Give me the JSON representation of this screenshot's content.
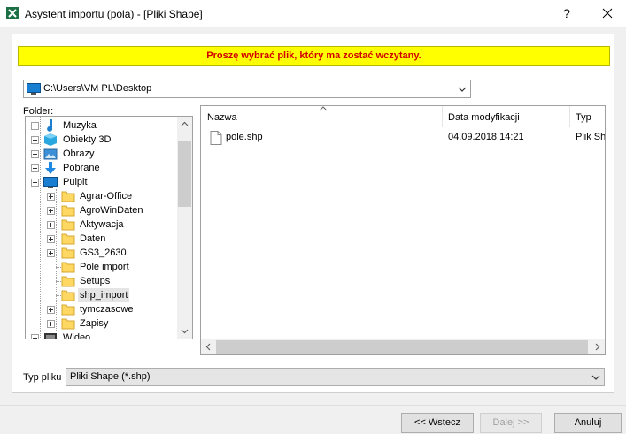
{
  "window": {
    "title": "Asystent importu (pola) - [Pliki Shape]",
    "help_label": "?",
    "app_icon": "excel-x-icon",
    "close_icon": "close-icon"
  },
  "banner": {
    "text": "Proszę wybrać plik, który ma zostać wczytany.",
    "background": "#ffff00",
    "text_color": "#d00000"
  },
  "path_combo": {
    "value": "C:\\Users\\VM PL\\Desktop",
    "icon": "monitor-icon"
  },
  "tree": {
    "label": "Folder:",
    "items": [
      {
        "label": "Muzyka",
        "icon": "music-folder-icon",
        "expander": "plus"
      },
      {
        "label": "Obiekty 3D",
        "icon": "3d-objects-icon",
        "expander": "plus"
      },
      {
        "label": "Obrazy",
        "icon": "pictures-folder-icon",
        "expander": "plus"
      },
      {
        "label": "Pobrane",
        "icon": "downloads-icon",
        "expander": "plus"
      },
      {
        "label": "Pulpit",
        "icon": "desktop-icon",
        "expander": "minus"
      },
      {
        "label": "Agrar-Office",
        "icon": "folder-icon",
        "expander": "plus"
      },
      {
        "label": "AgroWinDaten",
        "icon": "folder-icon",
        "expander": "plus"
      },
      {
        "label": "Aktywacja",
        "icon": "folder-icon",
        "expander": "plus"
      },
      {
        "label": "Daten",
        "icon": "folder-icon",
        "expander": "plus"
      },
      {
        "label": "GS3_2630",
        "icon": "folder-icon",
        "expander": "plus"
      },
      {
        "label": "Pole import",
        "icon": "folder-icon",
        "expander": "none"
      },
      {
        "label": "Setups",
        "icon": "folder-icon",
        "expander": "none"
      },
      {
        "label": "shp_import",
        "icon": "folder-icon",
        "expander": "none",
        "selected": true
      },
      {
        "label": "tymczasowe",
        "icon": "folder-icon",
        "expander": "plus"
      },
      {
        "label": "Zapisy",
        "icon": "folder-icon",
        "expander": "plus"
      },
      {
        "label": "Wideo",
        "icon": "video-folder-icon",
        "expander": "plus"
      }
    ]
  },
  "file_list": {
    "columns": [
      "Nazwa",
      "Data modyfikacji",
      "Typ"
    ],
    "rows": [
      {
        "name": "pole.shp",
        "modified": "04.09.2018 14:21",
        "type": "Plik Sh"
      }
    ]
  },
  "file_type": {
    "label": "Typ pliku",
    "value": "Pliki Shape (*.shp)"
  },
  "buttons": {
    "back": "<< Wstecz",
    "next": "Dalej >>",
    "cancel": "Anuluj"
  }
}
